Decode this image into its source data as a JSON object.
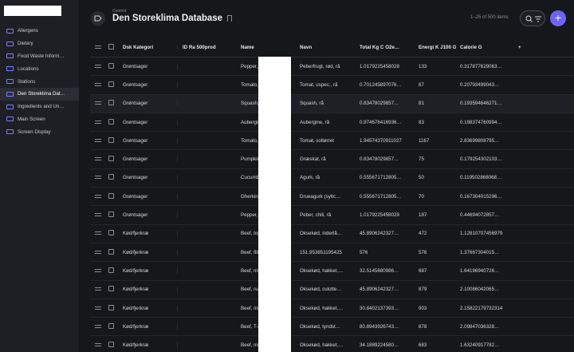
{
  "sidebar": {
    "items": [
      {
        "label": "Allergens",
        "active": false
      },
      {
        "label": "Dietary",
        "active": false
      },
      {
        "label": "Food Waste Inform…",
        "active": false
      },
      {
        "label": "Locations",
        "active": false
      },
      {
        "label": "Stations",
        "active": false
      },
      {
        "label": "Den Storeklima Dat…",
        "active": true
      },
      {
        "label": "Ingredients and Un…",
        "active": false
      },
      {
        "label": "Main Screen",
        "active": false
      },
      {
        "label": "Screen Display",
        "active": false
      }
    ]
  },
  "header": {
    "breadcrumb": "Content",
    "title": "Den Storeklima Database",
    "count": "1–25 of 500 items",
    "add_label": "+"
  },
  "table": {
    "columns": [
      "Dsk Kategori",
      "ID Ra 500prod",
      "Name",
      "Navn",
      "Total Kg C O2e…",
      "Energi K J100 G",
      "Calorie G"
    ],
    "rows": [
      [
        "Grøntsager",
        "",
        "Pepper, sweet, r…",
        "Peberfrugt, rød, rå",
        "1.0179225458028",
        "133",
        "0.317877629063…"
      ],
      [
        "Grøntsager",
        "",
        "Tomato, ripe, raw…",
        "Tomat, uspec., rå",
        "0.701245897076…",
        "87",
        "0.20793499043…"
      ],
      [
        "Grøntsager",
        "",
        "Squash, raw",
        "Squash, rå",
        "0.83478029857…",
        "81",
        "0.193594646271…"
      ],
      [
        "Grøntsager",
        "",
        "Aubergine, raw",
        "Aubergine, rå",
        "0.974676416936…",
        "83",
        "0.198374760994…"
      ],
      [
        "Grøntsager",
        "",
        "Tomato, dried",
        "Tomat, soltørret",
        "1.94574370911027",
        "1167",
        "2.83699808795…"
      ],
      [
        "Grøntsager",
        "",
        "Pumpkin, raw",
        "Græskar, rå",
        "0.83478029857…",
        "75",
        "0.179254302103…"
      ],
      [
        "Grøntsager",
        "",
        "Cucumber, raw",
        "Agurk, rå",
        "0.555671712805…",
        "50",
        "0.119502868068…"
      ],
      [
        "Grøntsager",
        "",
        "Gherkin cucumb…",
        "Drueagurk (syltc…",
        "0.555671712805…",
        "70",
        "0.167304015296…"
      ],
      [
        "Grøntsager",
        "",
        "Pepper, hot chili, …",
        "Peber, chili, rå",
        "1.0179225458028",
        "187",
        "0.44694072857…"
      ],
      [
        "Kød/fjerkræ",
        "",
        "Beef, topside, ca…",
        "Oksekød, inderlå…",
        "45.8906242327…",
        "472",
        "1.12810707456979"
      ],
      [
        "Kød/fjerkræ",
        "",
        "Beef, fillet, defatt…",
        "151.953851195425",
        "576",
        "576",
        "1.37667304015…"
      ],
      [
        "Kød/fjerkræ",
        "",
        "Beef, mince, 10-1…",
        "Oksekød, hakket,…",
        "32.5145680986…",
        "687",
        "1.64196940726…"
      ],
      [
        "Kød/fjerkræ",
        "",
        "Beef, rump, raw",
        "Oksekød, culotte…",
        "45.8906242327…",
        "879",
        "2.10086042065…"
      ],
      [
        "Kød/fjerkræ",
        "",
        "Beef, mince, 15-2…",
        "Oksekød, hakket,…",
        "30.8402137393…",
        "903",
        "2.15822179732314"
      ],
      [
        "Kød/fjerkræ",
        "",
        "Beef, T-bone ste…",
        "Oksekød, tyndst…",
        "80.8943926743…",
        "878",
        "2.09847036328…"
      ],
      [
        "Kød/fjerkræ",
        "",
        "Beef, mince, 5-1…",
        "Oksekød, hakket,…",
        "34.1889224580…",
        "683",
        "1.63240917782…"
      ]
    ]
  },
  "colors": {
    "accent": "#6f63f5",
    "sidebar_bg": "#1e1f24",
    "main_bg": "#16171b"
  }
}
